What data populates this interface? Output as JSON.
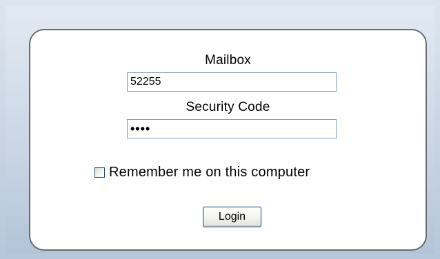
{
  "login_form": {
    "mailbox_label": "Mailbox",
    "mailbox_value": "52255",
    "security_label": "Security Code",
    "security_value": "••••",
    "remember_label": "Remember me on this computer",
    "remember_checked": false,
    "login_label": "Login"
  }
}
